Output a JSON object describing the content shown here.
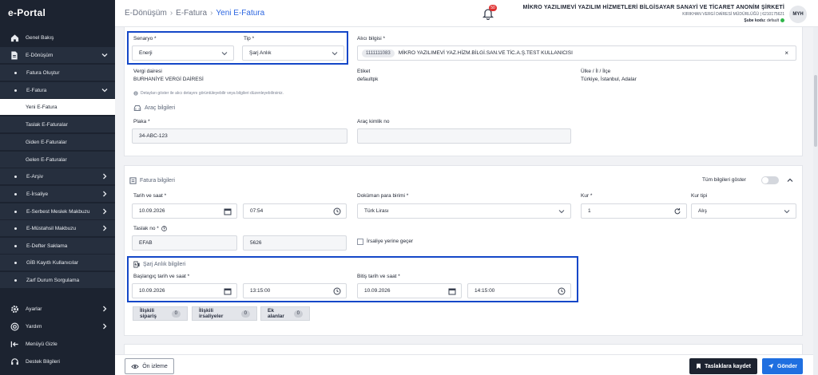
{
  "app": {
    "logo": "e-Portal"
  },
  "sidebar": {
    "items": [
      {
        "label": "Genel Bakış",
        "icon": "home-icon"
      },
      {
        "label": "E-Dönüşüm",
        "icon": "document-icon"
      },
      {
        "label": "Fatura Oluştur"
      },
      {
        "label": "E-Fatura"
      },
      {
        "label": "Yeni E-Fatura"
      },
      {
        "label": "Taslak E-Faturalar"
      },
      {
        "label": "Giden E-Faturalar"
      },
      {
        "label": "Gelen E-Faturalar"
      },
      {
        "label": "E-Arşiv"
      },
      {
        "label": "E-İrsaliye"
      },
      {
        "label": "E-Serbest Meslek Makbuzu"
      },
      {
        "label": "E-Müstahsil Makbuzu"
      },
      {
        "label": "E-Defter Saklama"
      },
      {
        "label": "GİB Kayıtlı Kullanıcılar"
      },
      {
        "label": "Zarf Durum Sorgulama"
      },
      {
        "label": "Ayarlar",
        "icon": "gear-icon"
      },
      {
        "label": "Yardım",
        "icon": "help-icon"
      },
      {
        "label": "Menüyü Gizle",
        "icon": "collapse-menu-icon"
      },
      {
        "label": "Destek Bilgileri",
        "icon": "support-icon"
      }
    ]
  },
  "header": {
    "breadcrumb": [
      "E-Dönüşüm",
      "E-Fatura",
      "Yeni E-Fatura"
    ],
    "notification_count": "50",
    "company_name": "MİKRO YAZILIMEVİ YAZILIM HİZMETLERİ BİLGİSAYAR SANAYİ VE TİCARET ANONİM ŞİRKETİ",
    "tax_info": "KIRIKHAN VERGİ DAİRESİ MÜDÜRLÜĞÜ | 6210175621",
    "branch_label": "Şube kodu:",
    "branch_value": "default",
    "avatar_initials": "MYH"
  },
  "general": {
    "scenario_label": "Senaryo *",
    "scenario_value": "Enerji",
    "type_label": "Tip *",
    "type_value": "Şarj Anlık",
    "receiver_label": "Alıcı bilgisi *",
    "receiver_tag": "1111111083",
    "receiver_name": "MİKRO YAZILIMEVİ YAZ.HİZM.BİLGİ.SAN.VE TİC.A.Ş.TEST KULLANICISI",
    "tax_office_label": "Vergi dairesi",
    "tax_office_value": "BURHANİYE VERGİ DAİRESİ",
    "tag_label": "Etiket",
    "tag_value": "defaultpk",
    "country_label": "Ülke / İl / İlçe",
    "country_value": "Türkiye, İstanbul, Adalar",
    "info_note": "Detayları göster ile alıcı detayını görüntüleyebilir veya bilgileri düzenleyebilirsiniz.",
    "vehicle_title": "Araç bilgileri",
    "plate_label": "Plaka *",
    "plate_value": "34-ABC-123",
    "vehicle_id_label": "Araç kimlik no",
    "vehicle_id_value": ""
  },
  "invoice": {
    "title": "Fatura bilgileri",
    "show_all_label": "Tüm bilgileri göster",
    "date_label": "Tarih ve saat *",
    "date_value": "10.09.2026",
    "time_value": "07:54",
    "currency_label": "Doküman para birimi *",
    "currency_value": "Türk Lirası",
    "rate_label": "Kur *",
    "rate_value": "1",
    "rate_type_label": "Kur tipi",
    "rate_type_value": "Alış",
    "draft_no_label": "Taslak no *",
    "draft_prefix": "EFAB",
    "draft_number": "5626",
    "dispatch_label": "İrsaliye yerine geçer",
    "charge_title": "Şarj Anlık bilgileri",
    "start_label": "Başlangıç tarih ve saat *",
    "start_date": "10.09.2026",
    "start_time": "13:15:00",
    "end_label": "Bitiş tarih ve saat *",
    "end_date": "10.09.2026",
    "end_time": "14:15:00",
    "tabs": [
      {
        "label": "İlişkili sipariş",
        "count": "0"
      },
      {
        "label": "İlişkili irsaliyeler",
        "count": "0"
      },
      {
        "label": "Ek alanlar",
        "count": "0"
      }
    ]
  },
  "footer": {
    "preview_label": "Ön izleme",
    "save_draft_label": "Taslaklara kaydet",
    "send_label": "Gönder"
  },
  "colors": {
    "sidebar": "#1c2330",
    "accent": "#2c66e0",
    "highlight": "#1447c8",
    "send": "#1f6fe0"
  }
}
